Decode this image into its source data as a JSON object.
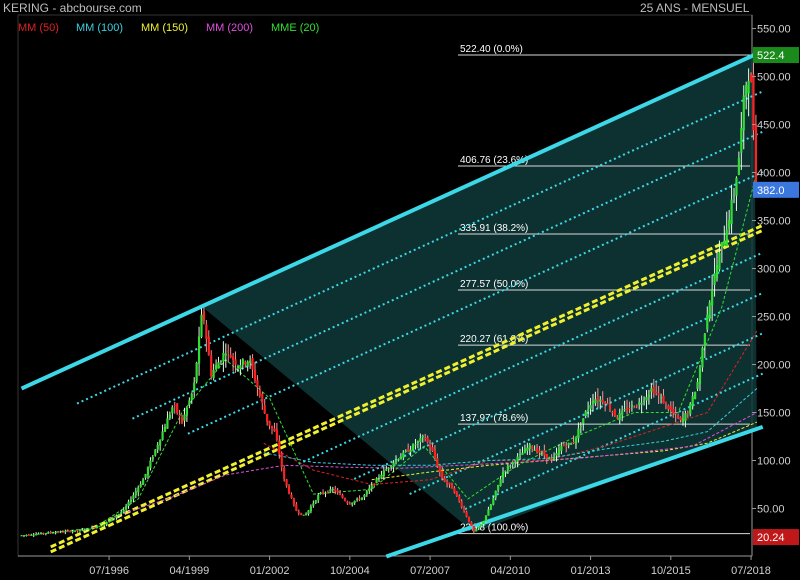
{
  "header": {
    "title": "KERING - abcbourse.com",
    "period": "25 ANS - MENSUEL"
  },
  "legend": [
    {
      "label": "MM (50)",
      "color": "#e02020"
    },
    {
      "label": "MM (100)",
      "color": "#39d0e0"
    },
    {
      "label": "MM (150)",
      "color": "#f0f030"
    },
    {
      "label": "MM (200)",
      "color": "#e050e0"
    },
    {
      "label": "MME (20)",
      "color": "#30e030"
    }
  ],
  "chart_data": {
    "type": "candlestick",
    "title": "KERING",
    "ylim": [
      0,
      560
    ],
    "y_ticks": [
      50,
      100,
      150,
      200,
      250,
      300,
      350,
      400,
      450,
      500,
      550
    ],
    "y_tick_labels": [
      "50.00",
      "100.00",
      "150.00",
      "200.00",
      "250.00",
      "300.00",
      "350.00",
      "400.00",
      "450.00",
      "500.00",
      "550.00"
    ],
    "x_tick_labels": [
      "07/1996",
      "04/1999",
      "01/2002",
      "10/2004",
      "07/2007",
      "04/2010",
      "01/2013",
      "10/2015",
      "07/2018"
    ],
    "price_markers": [
      {
        "label": "522.4",
        "value": 522.4,
        "color": "#1a8a1a"
      },
      {
        "label": "382.0",
        "value": 382.0,
        "color": "#3a78e0"
      },
      {
        "label": "20.24",
        "value": 20.24,
        "color": "#c01818"
      }
    ],
    "fibonacci": [
      {
        "label": "522.40  (0.0%)",
        "value": 522.4
      },
      {
        "label": "406.76  (23.6%)",
        "value": 406.76
      },
      {
        "label": "335.91  (38.2%)",
        "value": 335.91
      },
      {
        "label": "277.57  (50.0%)",
        "value": 277.57
      },
      {
        "label": "220.27  (61.8%)",
        "value": 220.27
      },
      {
        "label": "137.97  (78.6%)",
        "value": 137.97
      },
      {
        "label": "23.78  (100.0%)",
        "value": 23.78
      }
    ],
    "price_path": [
      [
        1993.5,
        22
      ],
      [
        1994.5,
        25
      ],
      [
        1995.5,
        27
      ],
      [
        1996.3,
        33
      ],
      [
        1997.0,
        48
      ],
      [
        1997.7,
        82
      ],
      [
        1998.2,
        120
      ],
      [
        1998.7,
        158
      ],
      [
        1999.0,
        140
      ],
      [
        1999.4,
        175
      ],
      [
        1999.7,
        258
      ],
      [
        2000.0,
        190
      ],
      [
        2000.5,
        215
      ],
      [
        2000.9,
        200
      ],
      [
        2001.3,
        205
      ],
      [
        2001.6,
        175
      ],
      [
        2001.9,
        142
      ],
      [
        2002.2,
        128
      ],
      [
        2002.5,
        80
      ],
      [
        2002.9,
        48
      ],
      [
        2003.2,
        42
      ],
      [
        2003.7,
        65
      ],
      [
        2004.2,
        70
      ],
      [
        2004.7,
        55
      ],
      [
        2005.2,
        62
      ],
      [
        2005.8,
        85
      ],
      [
        2006.3,
        100
      ],
      [
        2006.8,
        112
      ],
      [
        2007.3,
        125
      ],
      [
        2007.6,
        108
      ],
      [
        2007.9,
        82
      ],
      [
        2008.3,
        70
      ],
      [
        2008.7,
        45
      ],
      [
        2009.0,
        26
      ],
      [
        2009.3,
        35
      ],
      [
        2009.6,
        55
      ],
      [
        2010.0,
        88
      ],
      [
        2010.4,
        100
      ],
      [
        2010.9,
        115
      ],
      [
        2011.3,
        108
      ],
      [
        2011.7,
        100
      ],
      [
        2012.0,
        115
      ],
      [
        2012.4,
        118
      ],
      [
        2012.8,
        148
      ],
      [
        2013.1,
        165
      ],
      [
        2013.5,
        162
      ],
      [
        2013.9,
        145
      ],
      [
        2014.3,
        155
      ],
      [
        2014.7,
        160
      ],
      [
        2015.1,
        175
      ],
      [
        2015.4,
        165
      ],
      [
        2015.8,
        150
      ],
      [
        2016.1,
        140
      ],
      [
        2016.4,
        155
      ],
      [
        2016.7,
        185
      ],
      [
        2017.0,
        255
      ],
      [
        2017.3,
        300
      ],
      [
        2017.6,
        335
      ],
      [
        2017.9,
        375
      ],
      [
        2018.1,
        420
      ],
      [
        2018.3,
        490
      ],
      [
        2018.45,
        508
      ],
      [
        2018.55,
        470
      ],
      [
        2018.65,
        400
      ],
      [
        2018.72,
        382
      ]
    ],
    "moving_averages": [
      {
        "name": "MM (50)",
        "color": "#e02020",
        "points": [
          [
            2001.8,
            118
          ],
          [
            2003.5,
            90
          ],
          [
            2005.5,
            75
          ],
          [
            2007.5,
            80
          ],
          [
            2009.5,
            100
          ],
          [
            2011.5,
            100
          ],
          [
            2013.5,
            115
          ],
          [
            2015.5,
            135
          ],
          [
            2017.0,
            150
          ],
          [
            2018.7,
            235
          ]
        ]
      },
      {
        "name": "MM (100)",
        "color": "#39d0e0",
        "points": [
          [
            2001.8,
            108
          ],
          [
            2003.5,
            98
          ],
          [
            2005.5,
            95
          ],
          [
            2007.5,
            95
          ],
          [
            2009.5,
            100
          ],
          [
            2011.5,
            102
          ],
          [
            2013.5,
            112
          ],
          [
            2015.5,
            120
          ],
          [
            2017.0,
            130
          ],
          [
            2018.7,
            175
          ]
        ]
      },
      {
        "name": "MM (150)",
        "color": "#f0f030",
        "points": [
          [
            2005.5,
            80
          ],
          [
            2007.5,
            88
          ],
          [
            2009.5,
            95
          ],
          [
            2011.5,
            100
          ],
          [
            2013.5,
            105
          ],
          [
            2015.5,
            110
          ],
          [
            2017.0,
            118
          ],
          [
            2018.7,
            140
          ]
        ]
      },
      {
        "name": "MM (200)",
        "color": "#e050e0",
        "points": [
          [
            1996.5,
            40
          ],
          [
            1998.5,
            60
          ],
          [
            2000.5,
            85
          ],
          [
            2002.5,
            95
          ],
          [
            2004.5,
            93
          ],
          [
            2006.5,
            92
          ],
          [
            2008.5,
            95
          ],
          [
            2010.5,
            98
          ],
          [
            2012.5,
            102
          ],
          [
            2014.5,
            108
          ],
          [
            2016.5,
            115
          ],
          [
            2018.7,
            150
          ]
        ]
      },
      {
        "name": "MME (20)",
        "color": "#30e030",
        "points": [
          [
            1994.0,
            23
          ],
          [
            1996.0,
            30
          ],
          [
            1997.5,
            60
          ],
          [
            1999.0,
            150
          ],
          [
            2000.5,
            205
          ],
          [
            2002.0,
            165
          ],
          [
            2003.5,
            65
          ],
          [
            2005.5,
            70
          ],
          [
            2007.3,
            115
          ],
          [
            2008.8,
            60
          ],
          [
            2010.5,
            95
          ],
          [
            2012.5,
            125
          ],
          [
            2014.5,
            150
          ],
          [
            2016.0,
            150
          ],
          [
            2017.5,
            260
          ],
          [
            2018.7,
            400
          ]
        ]
      }
    ]
  }
}
